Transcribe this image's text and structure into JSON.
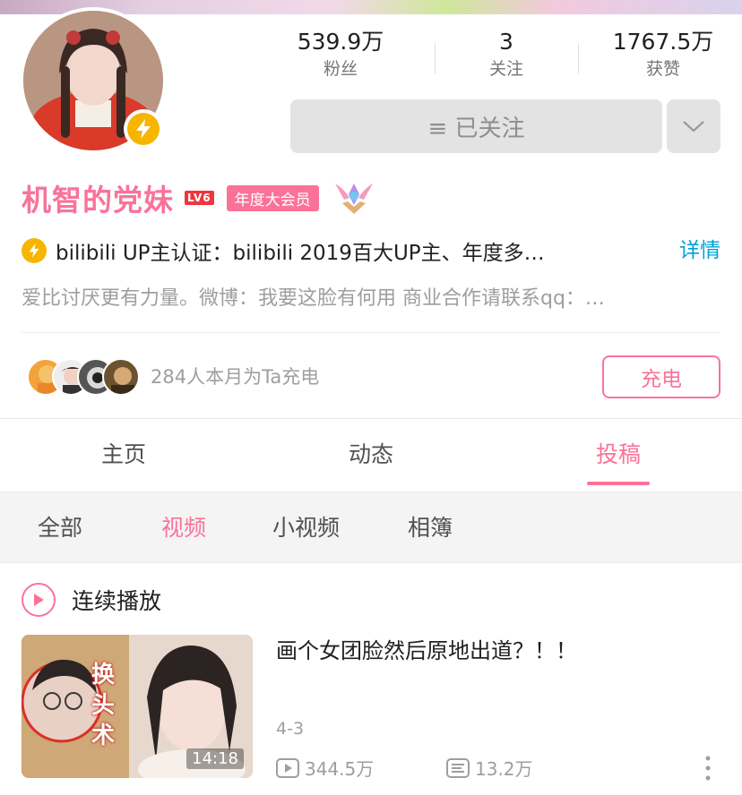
{
  "profile": {
    "name": "机智的党妹",
    "level": "LV6",
    "vip_tag": "年度大会员",
    "certification": "bilibili  UP主认证：bilibili  2019百大UP主、年度多…",
    "detail_link": "详情",
    "sign": "爱比讨厌更有力量。微博：我要这脸有何用  商业合作请联系qq：…"
  },
  "stats": {
    "fans_value": "539.9万",
    "fans_label": "粉丝",
    "following_value": "3",
    "following_label": "关注",
    "likes_value": "1767.5万",
    "likes_label": "获赞"
  },
  "follow_button": "≡ 已关注",
  "charge": {
    "text": "284人本月为Ta充电",
    "button": "充电"
  },
  "tabs": [
    "主页",
    "动态",
    "投稿"
  ],
  "subtabs": [
    "全部",
    "视频",
    "小视频",
    "相簿"
  ],
  "continuous_play": "连续播放",
  "video": {
    "title": "画个女团脸然后原地出道？！！",
    "duration": "14:18",
    "thumb_caption": "换头术",
    "date": "4-3",
    "views": "344.5万",
    "danmaku": "13.2万"
  },
  "colors": {
    "brand_pink": "#fb7299",
    "link_blue": "#00a1d6",
    "verify_yellow": "#f7b500"
  }
}
